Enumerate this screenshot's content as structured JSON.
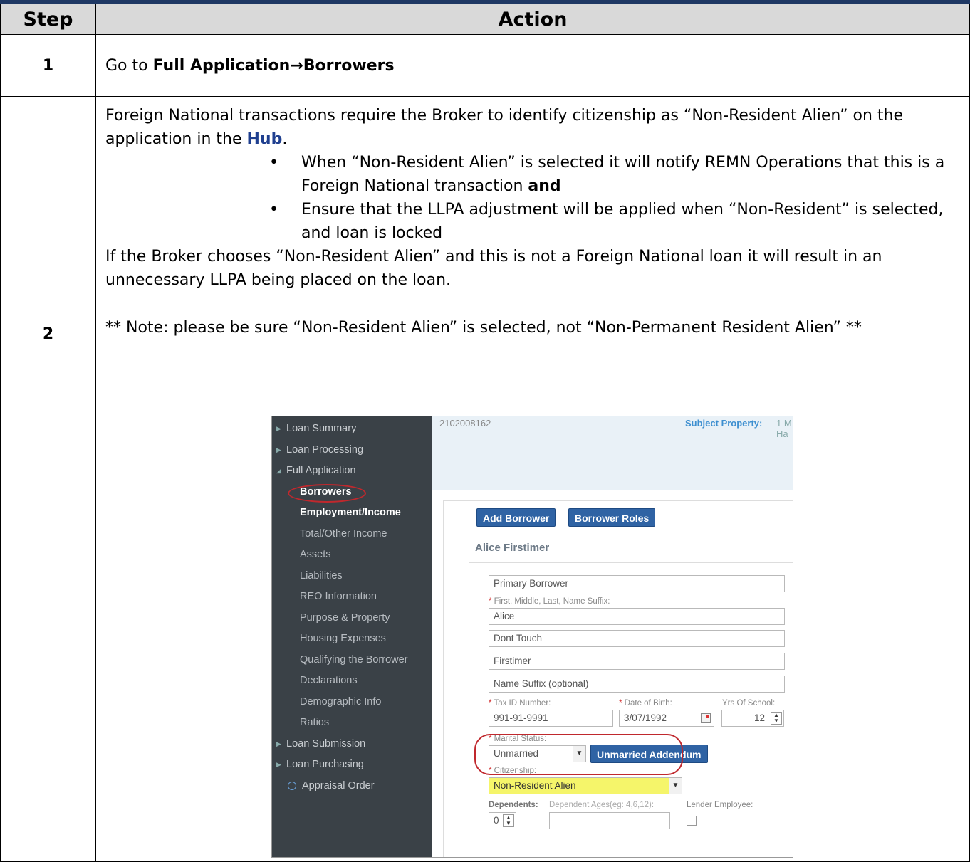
{
  "table": {
    "header": {
      "step": "Step",
      "action": "Action"
    },
    "row1": {
      "step": "1",
      "go_to": "Go to",
      "path": "Full Application→Borrowers"
    },
    "row2": {
      "step": "2",
      "para1_a": "Foreign National transactions require the Broker to identify citizenship as “Non-Resident Alien” on the application in the",
      "hub": "Hub",
      "para1_end": ".",
      "bullet1": "When “Non-Resident Alien” is selected it will notify REMN Operations that this is a Foreign National transaction",
      "bullet1_bold": "and",
      "bullet2": "Ensure that the LLPA adjustment will be applied when “Non-Resident” is selected, and loan is locked",
      "para2": "If the Broker chooses “Non-Resident Alien” and this is not a Foreign National loan it will result in an unnecessary LLPA being placed on the loan.",
      "note": "** Note: please be sure “Non-Resident Alien” is selected, not “Non-Permanent Resident Alien” **"
    }
  },
  "app": {
    "sidebar": {
      "loan_summary": "Loan Summary",
      "loan_processing": "Loan Processing",
      "full_application": "Full Application",
      "borrowers": "Borrowers",
      "employment_income": "Employment/Income",
      "total_other_income": "Total/Other Income",
      "assets": "Assets",
      "liabilities": "Liabilities",
      "reo_information": "REO Information",
      "purpose_property": "Purpose & Property",
      "housing_expenses": "Housing Expenses",
      "qualifying": "Qualifying the Borrower",
      "declarations": "Declarations",
      "demographic": "Demographic Info",
      "ratios": "Ratios",
      "loan_submission": "Loan Submission",
      "loan_purchasing": "Loan Purchasing",
      "appraisal_order": "Appraisal Order"
    },
    "header": {
      "loan_number": "2102008162",
      "subject_label": "Subject Property:",
      "subject_value_1": "1 M",
      "subject_value_2": "Ha"
    },
    "buttons": {
      "add_borrower": "Add Borrower",
      "borrower_roles": "Borrower Roles",
      "unmarried_addendum": "Unmarried Addendum"
    },
    "borrower_name": "Alice Firstimer",
    "form": {
      "role": "Primary Borrower",
      "name_label": "First, Middle, Last, Name Suffix:",
      "first": "Alice",
      "middle": "Dont Touch",
      "last": "Firstimer",
      "suffix_placeholder": "Name Suffix (optional)",
      "tax_id_label": "Tax ID Number:",
      "tax_id": "991-91-9991",
      "dob_label": "Date of Birth:",
      "dob": "3/07/1992",
      "school_label": "Yrs Of School:",
      "school": "12",
      "marital_label": "Marital Status:",
      "marital": "Unmarried",
      "citizenship_label": "Citizenship:",
      "citizenship": "Non-Resident Alien",
      "dependents_label": "Dependents:",
      "dependents": "0",
      "dependent_ages_label": "Dependent Ages(eg: 4,6,12):",
      "lender_employee_label": "Lender Employee:"
    }
  }
}
